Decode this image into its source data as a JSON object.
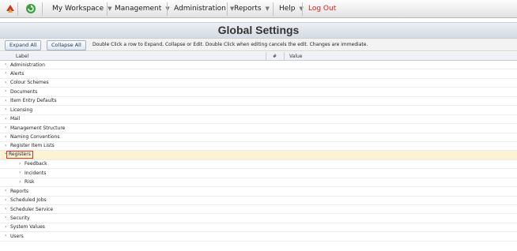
{
  "menu": {
    "items": [
      {
        "label": "My Workspace",
        "caret": "▼"
      },
      {
        "label": "Management",
        "caret": "▼"
      },
      {
        "label": "Administration",
        "caret": "▼"
      },
      {
        "label": "Reports",
        "caret": "▼"
      },
      {
        "label": "Help",
        "caret": "▼"
      }
    ],
    "logout": "Log Out",
    "icons": [
      "app-logo-icon",
      "refresh-icon"
    ]
  },
  "title": "Global Settings",
  "toolbar": {
    "expand_all": "Expand All",
    "collapse_all": "Collapse All",
    "hint": "Double Click a row to Expand, Collapse or Edit. Double Click when editing cancels the edit. Changes are immediate."
  },
  "grid": {
    "columns": {
      "label": "Label",
      "hash": "#",
      "value": "Value"
    },
    "rows": [
      {
        "label": "Administration",
        "arrow": "›",
        "level": 0
      },
      {
        "label": "Alerts",
        "arrow": "›",
        "level": 0
      },
      {
        "label": "Colour Schemes",
        "arrow": "›",
        "level": 0
      },
      {
        "label": "Documents",
        "arrow": "›",
        "level": 0
      },
      {
        "label": "Item Entry Defaults",
        "arrow": "›",
        "level": 0
      },
      {
        "label": "Licensing",
        "arrow": "›",
        "level": 0
      },
      {
        "label": "Mail",
        "arrow": "›",
        "level": 0
      },
      {
        "label": "Management Structure",
        "arrow": "›",
        "level": 0
      },
      {
        "label": "Naming Conventions",
        "arrow": "›",
        "level": 0
      },
      {
        "label": "Register Item Lists",
        "arrow": "›",
        "level": 0
      },
      {
        "label": "Registers",
        "arrow": "⌄",
        "level": 0,
        "selected": true
      },
      {
        "label": "Feedback",
        "arrow": "›",
        "level": 1
      },
      {
        "label": "Incidents",
        "arrow": "›",
        "level": 1
      },
      {
        "label": "Risk",
        "arrow": "›",
        "level": 1
      },
      {
        "label": "Reports",
        "arrow": "›",
        "level": 0
      },
      {
        "label": "Scheduled Jobs",
        "arrow": "›",
        "level": 0
      },
      {
        "label": "Scheduler Service",
        "arrow": "›",
        "level": 0
      },
      {
        "label": "Security",
        "arrow": "›",
        "level": 0
      },
      {
        "label": "System Values",
        "arrow": "›",
        "level": 0
      },
      {
        "label": "Users",
        "arrow": "›",
        "level": 0
      }
    ]
  },
  "colors": {
    "logout": "#d3221d",
    "selected_row": "#fdf3d2",
    "highlight_box": "#e0322b"
  }
}
